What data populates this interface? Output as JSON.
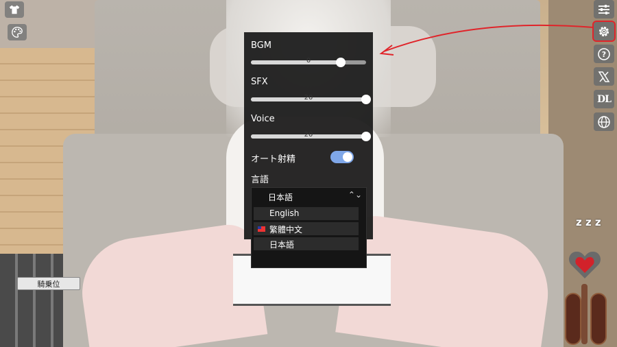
{
  "settings": {
    "bgm": {
      "label": "BGM",
      "value": "0",
      "level": 0.78
    },
    "sfx": {
      "label": "SFX",
      "value": "20",
      "level": 1.0
    },
    "voice": {
      "label": "Voice",
      "value": "20",
      "level": 1.0
    },
    "auto": {
      "label": "オート射精",
      "on": true
    },
    "language": {
      "label": "言語",
      "selected": "日本語",
      "options": [
        "English",
        "繁體中文",
        "日本語"
      ]
    }
  },
  "buttons": {
    "position": "騎乗位"
  },
  "toolbar": {
    "dl_label": "DL",
    "highlight_color": "#e0242a"
  },
  "indicators": {
    "sleep": "z z z"
  }
}
